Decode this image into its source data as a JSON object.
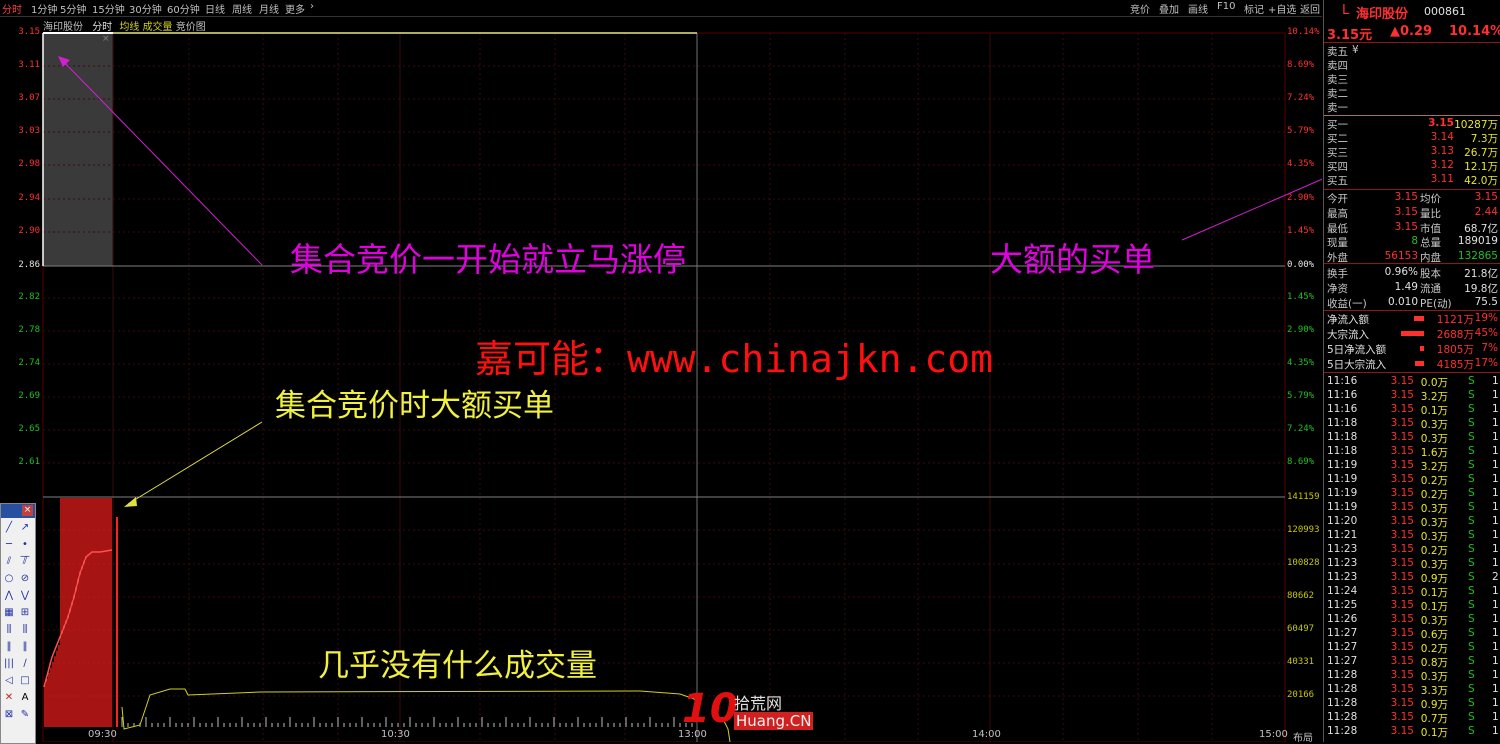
{
  "toolbar": {
    "periods": [
      "分时",
      "1分钟",
      "5分钟",
      "15分钟",
      "30分钟",
      "60分钟",
      "日线",
      "周线",
      "月线",
      "更多"
    ],
    "active_period": "分时",
    "right_buttons": [
      "竞价",
      "叠加",
      "画线",
      "F10",
      "标记",
      "+自选",
      "返回"
    ]
  },
  "chart": {
    "stock_name": "海印股份",
    "tabs": [
      "分时",
      "均线",
      "成交量",
      "竞价图"
    ],
    "price_axis": [
      "3.15",
      "3.11",
      "3.07",
      "3.03",
      "2.98",
      "2.94",
      "2.90",
      "2.86",
      "2.82",
      "2.78",
      "2.74",
      "2.69",
      "2.65",
      "2.61"
    ],
    "pct_axis": [
      "10.14%",
      "8.69%",
      "7.24%",
      "5.79%",
      "4.35%",
      "2.90%",
      "1.45%",
      "0.00%",
      "1.45%",
      "2.90%",
      "4.35%",
      "5.79%",
      "7.24%",
      "8.69%"
    ],
    "volume_axis": [
      "141159",
      "120993",
      "100828",
      "80662",
      "60497",
      "40331",
      "20166"
    ],
    "time_axis": [
      "09:30",
      "10:30",
      "13:00",
      "14:00",
      "15:00"
    ],
    "time_extra": "布局",
    "colors": {
      "up": "#ff3030",
      "down": "#20c020",
      "price_line": "#ffffff",
      "avg_line": "#c8c800",
      "annotation_magenta": "#e000e0",
      "annotation_yellow": "#f0f040"
    }
  },
  "annotations": {
    "auction_limit_up": "集合竞价一开始就立马涨停",
    "big_buy_order": "大额的买单",
    "watermark": "嘉可能：www.chinajkn.com",
    "auction_big_buy": "集合竞价时大额买单",
    "low_volume": "几乎没有什么成交量"
  },
  "logo": {
    "text1": "拾荒网",
    "text2": "Huang.CN",
    "number": "10"
  },
  "panel": {
    "header": {
      "prefix": "L",
      "name": "海印股份",
      "code": "000861"
    },
    "price": "3.15元",
    "change": "▲0.29",
    "change_pct": "10.14%",
    "asks": [
      {
        "label": "卖五",
        "mark": "¥"
      },
      {
        "label": "卖四"
      },
      {
        "label": "卖三"
      },
      {
        "label": "卖二"
      },
      {
        "label": "卖一"
      }
    ],
    "bids": [
      {
        "label": "买一",
        "price": "3.15",
        "vol": "10287万"
      },
      {
        "label": "买二",
        "price": "3.14",
        "vol": "7.3万"
      },
      {
        "label": "买三",
        "price": "3.13",
        "vol": "26.7万"
      },
      {
        "label": "买四",
        "price": "3.12",
        "vol": "12.1万"
      },
      {
        "label": "买五",
        "price": "3.11",
        "vol": "42.0万"
      }
    ],
    "stats": [
      {
        "l1": "今开",
        "v1": "3.15",
        "l2": "均价",
        "v2": "3.15"
      },
      {
        "l1": "最高",
        "v1": "3.15",
        "l2": "量比",
        "v2": "2.44"
      },
      {
        "l1": "最低",
        "v1": "3.15",
        "l2": "市值",
        "v2": "68.7亿"
      },
      {
        "l1": "现量",
        "v1": "8",
        "l2": "总量",
        "v2": "189019"
      },
      {
        "l1": "外盘",
        "v1": "56153",
        "l2": "内盘",
        "v2": "132865"
      }
    ],
    "stats2": [
      {
        "l1": "换手",
        "v1": "0.96%",
        "l2": "股本",
        "v2": "21.8亿"
      },
      {
        "l1": "净资",
        "v1": "1.49",
        "l2": "流通",
        "v2": "19.8亿"
      },
      {
        "l1": "收益(一)",
        "v1": "0.010",
        "l2": "PE(动)",
        "v2": "75.5"
      }
    ],
    "flows": [
      {
        "label": "净流入额",
        "value": "1121万",
        "pct": "19%",
        "fill": 0.19
      },
      {
        "label": "大宗流入",
        "value": "2688万",
        "pct": "45%",
        "fill": 0.45
      },
      {
        "label": "5日净流入额",
        "value": "1805万",
        "pct": "7%",
        "fill": 0.07
      },
      {
        "label": "5日大宗流入",
        "value": "4185万",
        "pct": "17%",
        "fill": 0.17
      }
    ],
    "ticks": [
      {
        "t": "11:16",
        "p": "3.15",
        "v": "0.0万",
        "s": "S",
        "n": "1"
      },
      {
        "t": "11:16",
        "p": "3.15",
        "v": "3.2万",
        "s": "S",
        "n": "1"
      },
      {
        "t": "11:16",
        "p": "3.15",
        "v": "0.1万",
        "s": "S",
        "n": "1"
      },
      {
        "t": "11:18",
        "p": "3.15",
        "v": "0.3万",
        "s": "S",
        "n": "1"
      },
      {
        "t": "11:18",
        "p": "3.15",
        "v": "0.3万",
        "s": "S",
        "n": "1"
      },
      {
        "t": "11:18",
        "p": "3.15",
        "v": "1.6万",
        "s": "S",
        "n": "1"
      },
      {
        "t": "11:19",
        "p": "3.15",
        "v": "3.2万",
        "s": "S",
        "n": "1"
      },
      {
        "t": "11:19",
        "p": "3.15",
        "v": "0.2万",
        "s": "S",
        "n": "1"
      },
      {
        "t": "11:19",
        "p": "3.15",
        "v": "0.2万",
        "s": "S",
        "n": "1"
      },
      {
        "t": "11:19",
        "p": "3.15",
        "v": "0.3万",
        "s": "S",
        "n": "1"
      },
      {
        "t": "11:20",
        "p": "3.15",
        "v": "0.3万",
        "s": "S",
        "n": "1"
      },
      {
        "t": "11:21",
        "p": "3.15",
        "v": "0.3万",
        "s": "S",
        "n": "1"
      },
      {
        "t": "11:23",
        "p": "3.15",
        "v": "0.2万",
        "s": "S",
        "n": "1"
      },
      {
        "t": "11:23",
        "p": "3.15",
        "v": "0.3万",
        "s": "S",
        "n": "1"
      },
      {
        "t": "11:23",
        "p": "3.15",
        "v": "0.9万",
        "s": "S",
        "n": "2"
      },
      {
        "t": "11:24",
        "p": "3.15",
        "v": "0.1万",
        "s": "S",
        "n": "1"
      },
      {
        "t": "11:25",
        "p": "3.15",
        "v": "0.1万",
        "s": "S",
        "n": "1"
      },
      {
        "t": "11:26",
        "p": "3.15",
        "v": "0.3万",
        "s": "S",
        "n": "1"
      },
      {
        "t": "11:27",
        "p": "3.15",
        "v": "0.6万",
        "s": "S",
        "n": "1"
      },
      {
        "t": "11:27",
        "p": "3.15",
        "v": "0.2万",
        "s": "S",
        "n": "1"
      },
      {
        "t": "11:27",
        "p": "3.15",
        "v": "0.8万",
        "s": "S",
        "n": "1"
      },
      {
        "t": "11:28",
        "p": "3.15",
        "v": "0.3万",
        "s": "S",
        "n": "1"
      },
      {
        "t": "11:28",
        "p": "3.15",
        "v": "3.3万",
        "s": "S",
        "n": "1"
      },
      {
        "t": "11:28",
        "p": "3.15",
        "v": "0.9万",
        "s": "S",
        "n": "1"
      },
      {
        "t": "11:28",
        "p": "3.15",
        "v": "0.7万",
        "s": "S",
        "n": "1"
      },
      {
        "t": "11:28",
        "p": "3.15",
        "v": "0.1万",
        "s": "S",
        "n": "1"
      }
    ]
  },
  "draw_tools": [
    "line-tool-icon",
    "arrow-tool-icon",
    "hline-tool-icon",
    "segment-tool-icon",
    "parallel-tool-icon",
    "channel-tool-icon",
    "circle-tool-icon",
    "fib-tool-icon",
    "wave-tool-icon",
    "zigzag-tool-icon",
    "grid-tool-icon",
    "gann-tool-icon",
    "fan-tool-icon",
    "speed-tool-icon",
    "period-tool-icon",
    "cycle-tool-icon",
    "bars-tool-icon",
    "trend-tool-icon",
    "triangle-tool-icon",
    "rect-tool-icon",
    "delete-tool-icon",
    "text-tool-icon",
    "close-tool-icon",
    "marker-tool-icon"
  ],
  "draw_text_label": "A"
}
